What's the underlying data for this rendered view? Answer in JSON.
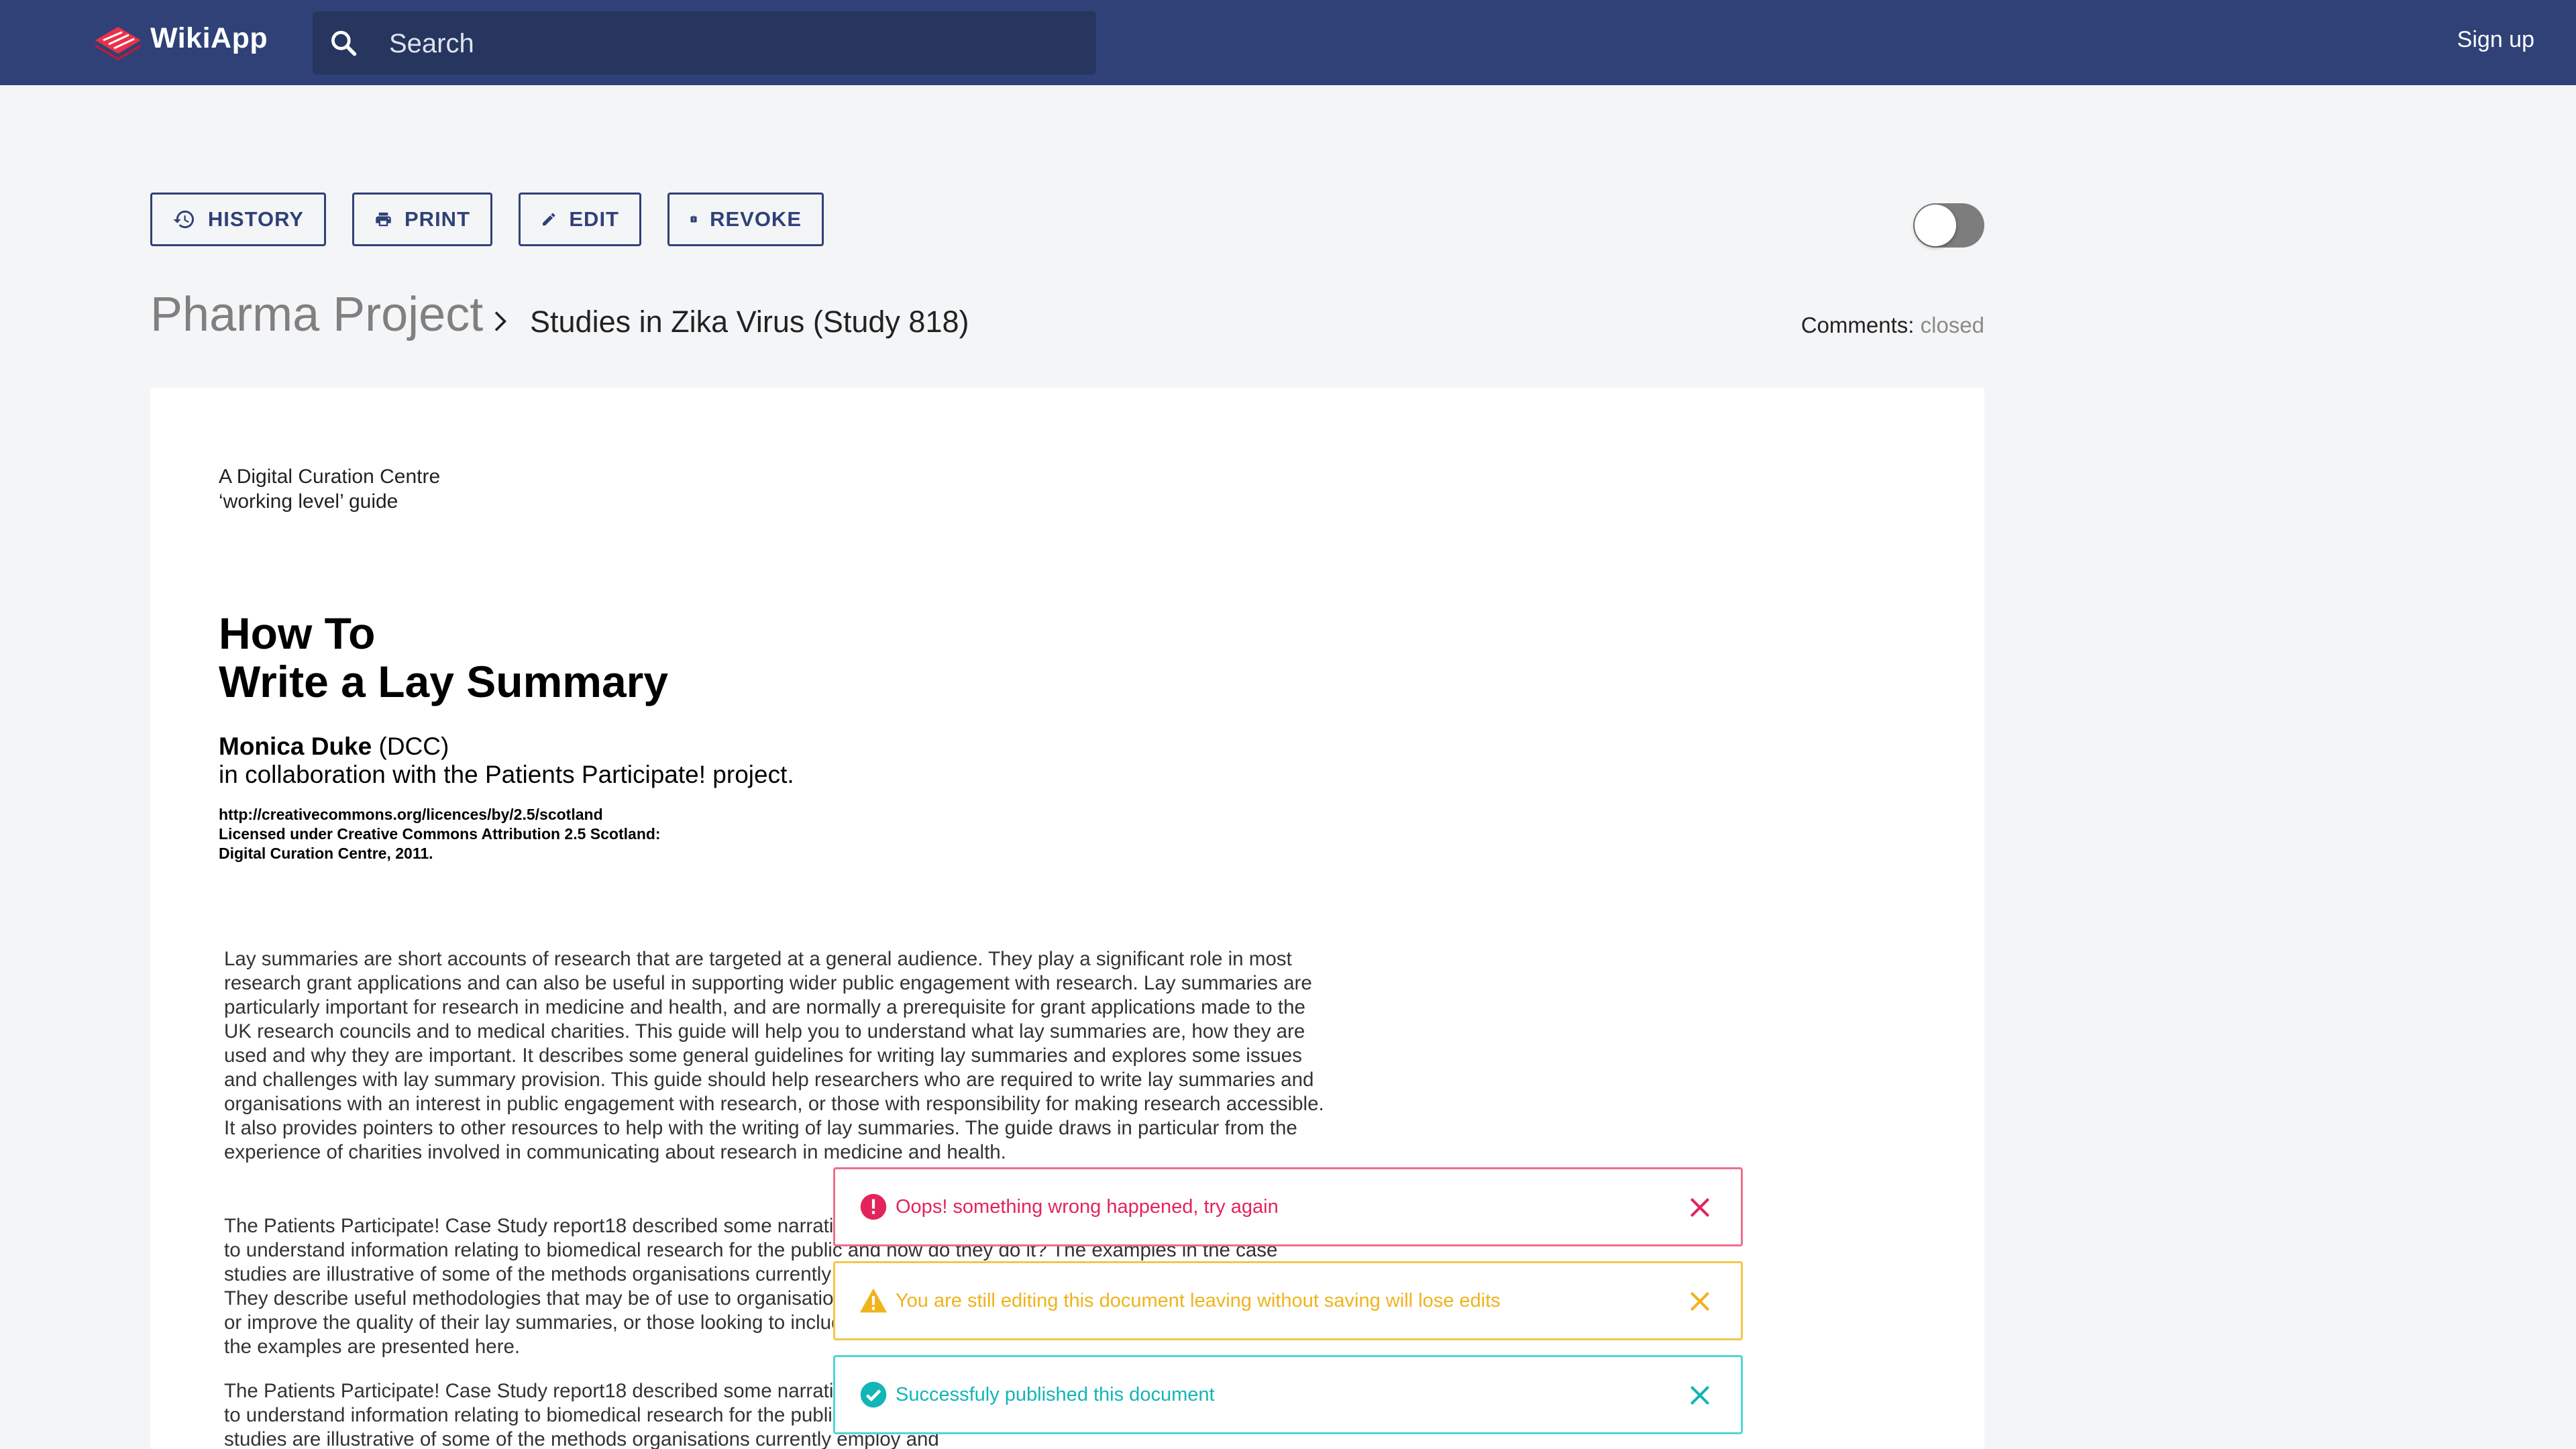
{
  "app": {
    "name": "WikiApp",
    "signup_label": "Sign up"
  },
  "search": {
    "placeholder": "Search"
  },
  "toolbar": {
    "history_label": "HISTORY",
    "print_label": "PRINT",
    "edit_label": "EDIT",
    "revoke_label": "REVOKE",
    "toggle_on": false
  },
  "breadcrumb": {
    "root": "Pharma Project",
    "current": "Studies in Zika Virus (Study 818)"
  },
  "comments": {
    "label": "Comments:",
    "value": "closed"
  },
  "document": {
    "guide_line1": "A Digital Curation Centre",
    "guide_line2": "‘working level’ guide",
    "title_line1": "How To",
    "title_line2": "Write a Lay Summary",
    "author_name": "Monica Duke",
    "author_org": "(DCC)",
    "collaboration": "in collaboration with the Patients Participate! project.",
    "license_line1": "http://creativecommons.org/licences/by/2.5/scotland",
    "license_line2": "Licensed under Creative Commons Attribution 2.5 Scotland:",
    "license_line3": "Digital Curation Centre, 2011.",
    "paragraph1": "Lay summaries are short accounts of research that are targeted at a general audience. They play a significant role in most research grant applications and can also be useful in supporting wider public engagement with research. Lay summaries are particularly important for research in medicine and health, and are normally a prerequisite for grant applications made to the UK research councils and to medical charities. This guide will help you to understand what lay summaries are, how they are used and why they are important. It describes some general guidelines for writing lay summaries and explores some issues and challenges with lay summary provision. This guide should help researchers who are required to write lay summaries and organisations with an interest in public engagement with research, or those with responsibility for making research accessible. It also provides pointers to other resources to help with the writing of lay summaries. The guide draws in particular from the experience of charities involved in communicating about research in medicine and health.",
    "paragraph2": "The Patients Participate! Case Study report18 described some narratives of how organisations are currently producing easy to understand information relating to biomedical research for the public and how do they do it? The examples in the case studies are illustrative of some of the methods organisations currently employ and some of the challenges in doing it well. They describe useful methodologies that may be of use to organisations just starting out, those trying to increase the volume or improve the quality of their lay summaries, or those looking to include patients in their activities in meaningful ways. Two of the examples are presented here.",
    "paragraph3": "The Patients Participate! Case Study report18 described some narratives of how organisations are currently producing easy to understand information relating to biomedical research for the public and how do they do it? The examples in the case studies are illustrative of some of the methods organisations currently employ and"
  },
  "toasts": {
    "error": "Oops! something wrong happened, try again",
    "warning": "You are still editing this document leaving without saving will lose edits",
    "success": "Successfuly published this document"
  },
  "colors": {
    "brand": "#2f4177",
    "error": "#e3245b",
    "warning": "#efb31b",
    "success": "#14b5b5"
  },
  "icons": {
    "logo": "wikiapp-logo-icon",
    "search": "search-icon",
    "history": "history-icon",
    "print": "printer-icon",
    "edit": "pencil-icon",
    "revoke": "clipboard-alert-icon",
    "breadcrumb_separator": "chevron-right-icon",
    "error": "error-circle-icon",
    "warning": "warning-triangle-icon",
    "success": "check-circle-icon",
    "close": "close-icon"
  }
}
